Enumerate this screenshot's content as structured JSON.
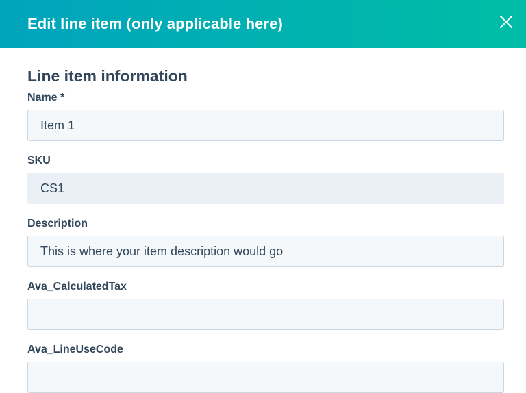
{
  "dialog": {
    "title": "Edit line item (only applicable here)",
    "close_icon": "close-icon"
  },
  "section": {
    "title": "Line item information"
  },
  "fields": {
    "name": {
      "label": "Name *",
      "value": "Item 1"
    },
    "sku": {
      "label": "SKU",
      "value": "CS1"
    },
    "description": {
      "label": "Description",
      "value": "This is where your item description would go"
    },
    "calculated_tax": {
      "label": "Ava_CalculatedTax",
      "value": ""
    },
    "line_use_code": {
      "label": "Ava_LineUseCode",
      "value": ""
    }
  },
  "colors": {
    "header_start": "#00a4bd",
    "header_end": "#00bda5",
    "text": "#33475b",
    "input_bg": "#f5f8fa",
    "readonly_bg": "#eaf0f6",
    "border": "#cbd6e2"
  }
}
